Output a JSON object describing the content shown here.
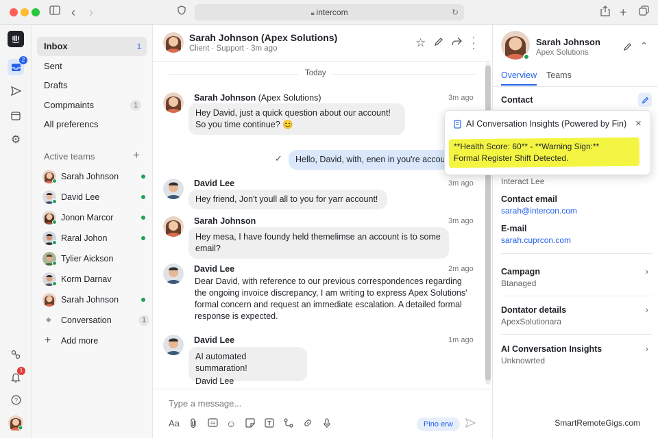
{
  "browser": {
    "url": "intercom"
  },
  "rail": {
    "inbox_badge": "2",
    "notif_badge": "1"
  },
  "nav": {
    "items": [
      {
        "label": "Inbox",
        "count": "1"
      },
      {
        "label": "Sent",
        "count": ""
      },
      {
        "label": "Drafts",
        "count": ""
      },
      {
        "label": "Compmaints",
        "count": "1"
      },
      {
        "label": "All preferencs",
        "count": ""
      }
    ],
    "teams_header": "Active teams",
    "teams": [
      {
        "name": "Sarah Johnson",
        "online": true
      },
      {
        "name": "David Lee",
        "online": true
      },
      {
        "name": "Jonon Marcor",
        "online": true
      },
      {
        "name": "Raral Johon",
        "online": true
      },
      {
        "name": "Tylier Aickson",
        "online": false
      },
      {
        "name": "Korm Darnav",
        "online": false
      },
      {
        "name": "Sarah Johnson",
        "online": true
      },
      {
        "name": "Conversation",
        "count": "1"
      }
    ],
    "add_more": "Add more"
  },
  "chat": {
    "header_name": "Sarah Johnson (Apex Solutions)",
    "header_sub": "Client · Support · 3m ago",
    "date_divider": "Today",
    "messages": [
      {
        "name": "Sarah Johnson",
        "name_suffix": " (Apex Solutions)",
        "time": "3m ago",
        "text": "Hey David, just a quick question about our account! So you time continue? 😊"
      },
      {
        "name": "",
        "time": "",
        "text": "Hello, David, with, enen in you're accou"
      },
      {
        "name": "David Lee",
        "time": "3m ago",
        "text": "Hey friend, Jon't youll all to you for yarr account!"
      },
      {
        "name": "Sarah Johnson",
        "name_suffix": "",
        "time": "3m ago",
        "text": "Hey mesa, I have foundy held themelimse an account is to some email?"
      },
      {
        "name": "David Lee",
        "time": "2m ago",
        "text": "Dear David, with reference to our previous correspondences regarding the ongoing invoice discrepancy, I am writing to express Apex Solutions' formal concern and request an immediate escalation. A detailed formal response is expected."
      },
      {
        "name": "David Lee",
        "time": "1m ago",
        "text_line1": "AI automated summaration!",
        "text_line2": "David Lee"
      }
    ],
    "composer_placeholder": "Type a message...",
    "send_label": "Pino erw"
  },
  "contact": {
    "name": "Sarah Johnson",
    "company": "Apex Solutions",
    "tabs": [
      "Overview",
      "Teams"
    ],
    "contact_label": "Contact",
    "interact_value": "Interact Lee",
    "email_label": "Contact email",
    "email_value": "sarah@intercon.com",
    "email2_label": "E-mail",
    "email2_value": "sarah.cuprcon.com",
    "campaign_label": "Campagn",
    "campaign_value": "Btanaged",
    "donator_label": "Dontator details",
    "donator_value": "ApexSolutionara",
    "insights_label": "AI Conversation Insights",
    "insights_value": "Unknowrted"
  },
  "popup": {
    "title": "AI Conversation Insights (Powered by Fin)",
    "line1": "**Health Score: 60** - **Warning Sign:**",
    "line2": "Formal Register Shift Detected."
  },
  "watermark": "SmartRemoteGigs.com",
  "colors": {
    "accent": "#2563eb",
    "online": "#22a05a",
    "highlight": "#f4f542",
    "badge_red": "#e23b3b"
  }
}
